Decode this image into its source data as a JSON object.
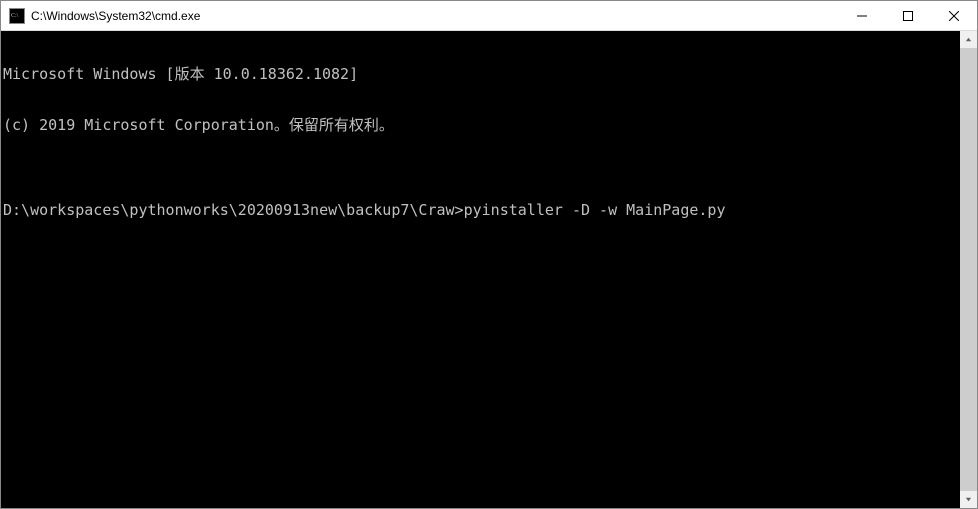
{
  "window": {
    "title": "C:\\Windows\\System32\\cmd.exe"
  },
  "terminal": {
    "line1": "Microsoft Windows [版本 10.0.18362.1082]",
    "line2": "(c) 2019 Microsoft Corporation。保留所有权利。",
    "blank": "",
    "prompt": "D:\\workspaces\\pythonworks\\20200913new\\backup7\\Craw>",
    "command": "pyinstaller -D -w MainPage.py"
  }
}
